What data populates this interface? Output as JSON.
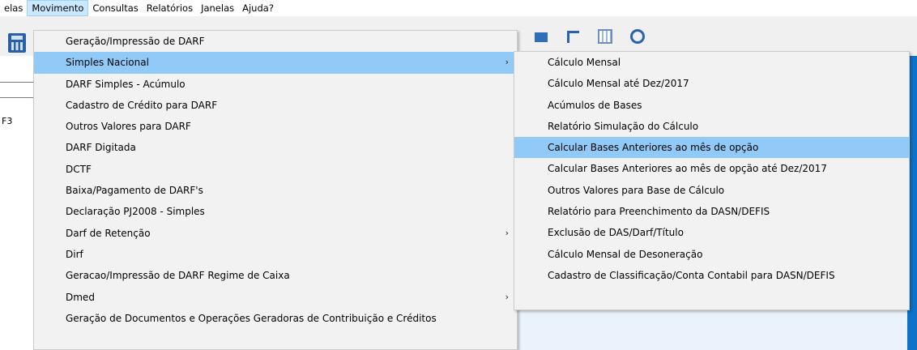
{
  "menubar": {
    "items": [
      {
        "label": "elas"
      },
      {
        "label": "Movimento"
      },
      {
        "label": "Consultas"
      },
      {
        "label": "Relatórios"
      },
      {
        "label": "Janelas"
      },
      {
        "label": "Ajuda?"
      }
    ]
  },
  "left_panel": {
    "shortcut_text": "F3"
  },
  "movimento_menu": {
    "items": [
      {
        "label": "Geração/Impressão de DARF"
      },
      {
        "label": "Simples Nacional",
        "submenu": "›"
      },
      {
        "label": "DARF Simples - Acúmulo"
      },
      {
        "label": "Cadastro de Crédito para DARF"
      },
      {
        "label": "Outros Valores para DARF"
      },
      {
        "label": "DARF Digitada"
      },
      {
        "label": "DCTF"
      },
      {
        "label": "Baixa/Pagamento de DARF's"
      },
      {
        "label": "Declaração PJ2008 - Simples"
      },
      {
        "label": "Darf de Retenção",
        "submenu": "›"
      },
      {
        "label": "Dirf"
      },
      {
        "label": "Geracao/Impressão de DARF Regime de Caixa"
      },
      {
        "label": "Dmed",
        "submenu": "›"
      },
      {
        "label": "Geração de Documentos e Operações Geradoras de Contribuição e Créditos"
      }
    ]
  },
  "simples_submenu": {
    "items": [
      {
        "label": "Cálculo Mensal"
      },
      {
        "label": "Cálculo Mensal até Dez/2017"
      },
      {
        "label": "Acúmulos de Bases"
      },
      {
        "label": "Relatório Simulação do Cálculo"
      },
      {
        "label": "Calcular Bases Anteriores ao mês de opção"
      },
      {
        "label": "Calcular Bases Anteriores ao mês de opção até Dez/2017"
      },
      {
        "label": "Outros Valores para Base de Cálculo"
      },
      {
        "label": "Relatório para Preenchimento da DASN/DEFIS"
      },
      {
        "label": "Exclusão de DAS/Darf/Título"
      },
      {
        "label": "Cálculo Mensal de Desoneração"
      },
      {
        "label": "Cadastro de Classificação/Conta Contabil para DASN/DEFIS"
      }
    ]
  },
  "colors": {
    "highlight": "#91c9f7",
    "menubar_active": "#cce8ff",
    "accent_blue": "#0e72c8"
  }
}
